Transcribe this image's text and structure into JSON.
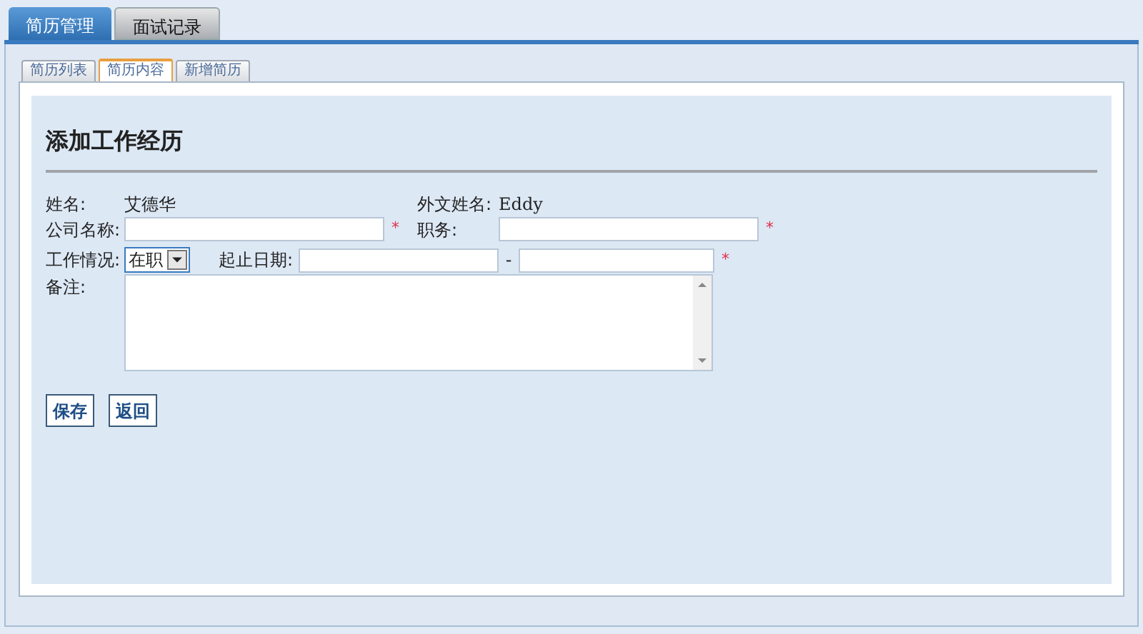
{
  "main_tabs": [
    {
      "label": "简历管理",
      "selected": true
    },
    {
      "label": "面试记录",
      "selected": false
    }
  ],
  "sub_tabs": [
    {
      "label": "简历列表",
      "selected": false
    },
    {
      "label": "简历内容",
      "selected": true
    },
    {
      "label": "新增简历",
      "selected": false
    }
  ],
  "heading": "添加工作经历",
  "form": {
    "name_label": "姓名:",
    "name_value": "艾德华",
    "foreign_name_label": "外文姓名:",
    "foreign_name_value": "Eddy",
    "company_label": "公司名称:",
    "company_required": true,
    "position_label": "职务:",
    "position_required": true,
    "status_label": "工作情况:",
    "status_value": "在职",
    "dates_label": "起止日期:",
    "dates_separator": "-",
    "dates_required": true,
    "remarks_label": "备注:",
    "required_mark": "*"
  },
  "buttons": [
    "保存",
    "返回"
  ]
}
